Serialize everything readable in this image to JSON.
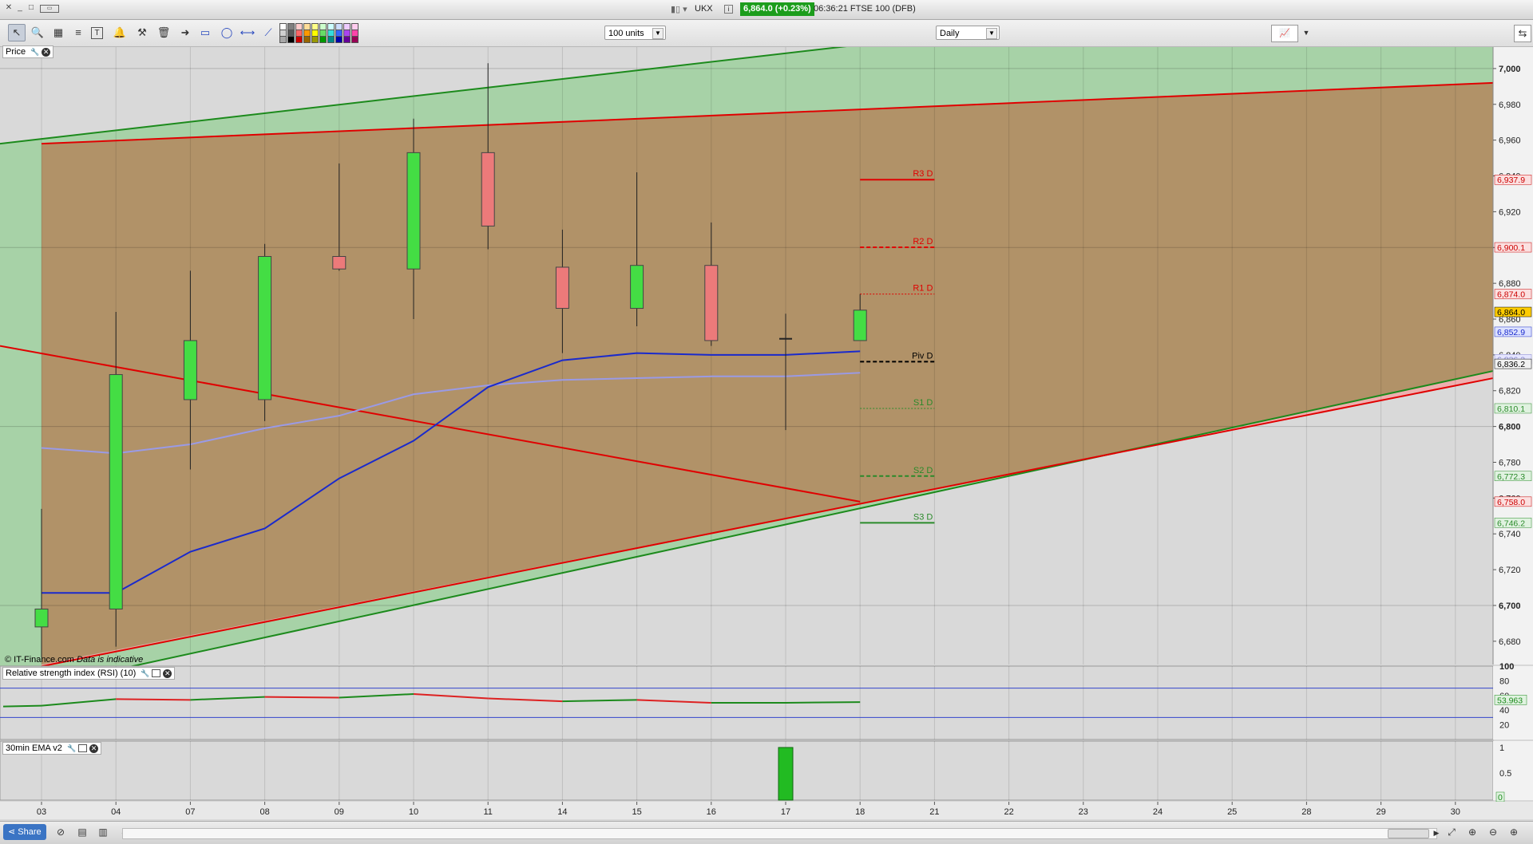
{
  "titlebar": {
    "symbol": "UKX",
    "quote": "6,864.0 (+0.23%)",
    "time_desc": "06:36:21 FTSE 100 (DFB)",
    "win_close": "✕",
    "win_min": "_",
    "win_max": "□",
    "win_pop": "▭"
  },
  "toolbar": {
    "units_select": "100 units",
    "interval_select": "Daily",
    "colors": [
      "#ffffff",
      "#d0d0d0",
      "#a8a8a8",
      "#808080",
      "#585858",
      "#000000",
      "#ffcccc",
      "#ff6666",
      "#cc0000",
      "#ffdd99",
      "#ff9900",
      "#996600",
      "#ffff88",
      "#ffff00",
      "#999900",
      "#ccffcc",
      "#66dd66",
      "#009900",
      "#ccffff",
      "#33dddd",
      "#008888",
      "#ccddff",
      "#3366ff",
      "#0000aa",
      "#eeccff",
      "#aa44ee",
      "#660099",
      "#ffccee",
      "#ff44aa",
      "#990055"
    ]
  },
  "price_panel": {
    "label": "Price"
  },
  "rsi_panel": {
    "label": "Relative strength index (RSI) (10)"
  },
  "ema_panel": {
    "label": "30min EMA v2"
  },
  "copyright": "© IT-Finance.com",
  "copyright_note": "Data is indicative",
  "share_label": "Share",
  "chart_data": {
    "type": "candlestick",
    "x_labels": [
      "03",
      "04",
      "07",
      "08",
      "09",
      "10",
      "11",
      "14",
      "15",
      "16",
      "17",
      "18",
      "21",
      "22",
      "23",
      "24",
      "25",
      "28",
      "29",
      "30"
    ],
    "price_ticks": [
      "6,680",
      "6,700",
      "6,720",
      "6,740",
      "6,760",
      "6,780",
      "6,800",
      "6,820",
      "6,840",
      "6,860",
      "6,880",
      "6,900",
      "6,920",
      "6,940",
      "6,960",
      "6,980",
      "7,000"
    ],
    "price_ylim": [
      6667,
      7012
    ],
    "candles": [
      {
        "day": "03",
        "open": 6688,
        "high": 6754,
        "low": 6671,
        "close": 6698
      },
      {
        "day": "04",
        "open": 6698,
        "high": 6864,
        "low": 6677,
        "close": 6829
      },
      {
        "day": "07",
        "open": 6815,
        "high": 6887,
        "low": 6776,
        "close": 6848
      },
      {
        "day": "08",
        "open": 6815,
        "high": 6902,
        "low": 6803,
        "close": 6895
      },
      {
        "day": "09",
        "open": 6895,
        "high": 6947,
        "low": 6887,
        "close": 6888
      },
      {
        "day": "10",
        "open": 6888,
        "high": 6972,
        "low": 6860,
        "close": 6953
      },
      {
        "day": "11",
        "open": 6953,
        "high": 7003,
        "low": 6899,
        "close": 6912
      },
      {
        "day": "14",
        "open": 6889,
        "high": 6910,
        "low": 6841,
        "close": 6866
      },
      {
        "day": "15",
        "open": 6866,
        "high": 6942,
        "low": 6856,
        "close": 6890
      },
      {
        "day": "16",
        "open": 6890,
        "high": 6914,
        "low": 6845,
        "close": 6848
      },
      {
        "day": "17",
        "open": 6849,
        "high": 6863,
        "low": 6798,
        "close": 6848
      },
      {
        "day": "18",
        "open": 6848,
        "high": 6874,
        "low": 6848,
        "close": 6865
      }
    ],
    "ema_blue": [
      6707,
      6707,
      6730,
      6743,
      6771,
      6792,
      6822,
      6837,
      6841,
      6840,
      6840,
      6842
    ],
    "ema_lavender": [
      6788,
      6785,
      6790,
      6799,
      6806,
      6818,
      6823,
      6826,
      6827,
      6828,
      6828,
      6830
    ],
    "pivots": [
      {
        "label": "R3 D",
        "value": 6937.9,
        "style": "solid",
        "color": "#e00000"
      },
      {
        "label": "R2 D",
        "value": 6900.1,
        "style": "dashed",
        "color": "#e00000"
      },
      {
        "label": "R1 D",
        "value": 6874.0,
        "style": "dotted",
        "color": "#e00000"
      },
      {
        "label": "Piv D",
        "value": 6836.2,
        "style": "dashed",
        "color": "#000000"
      },
      {
        "label": "S1 D",
        "value": 6810.1,
        "style": "dotted",
        "color": "#2a8a2a"
      },
      {
        "label": "S2 D",
        "value": 6772.3,
        "style": "dashed",
        "color": "#2a8a2a"
      },
      {
        "label": "S3 D",
        "value": 6746.2,
        "style": "solid",
        "color": "#2a8a2a"
      }
    ],
    "right_tags": [
      {
        "text": "6,937.9",
        "value": 6937.9,
        "bg": "#fbe0e0",
        "fg": "#cc0000"
      },
      {
        "text": "6,900.1",
        "value": 6900.1,
        "bg": "#fbe0e0",
        "fg": "#cc0000"
      },
      {
        "text": "6,874.0",
        "value": 6874.0,
        "bg": "#fbe0e0",
        "fg": "#cc0000"
      },
      {
        "text": "6,864.0",
        "value": 6864.0,
        "bg": "#ffcc00",
        "fg": "#000000"
      },
      {
        "text": "6,852.9",
        "value": 6852.9,
        "bg": "#dde2ff",
        "fg": "#1a2acc"
      },
      {
        "text": "6,836.2",
        "value": 6837.6,
        "bg": "#e6e6ff",
        "fg": "#8888cc"
      },
      {
        "text": "6,836.2",
        "value": 6835.0,
        "bg": "#f2f2f2",
        "fg": "#000000"
      },
      {
        "text": "6,810.1",
        "value": 6810.1,
        "bg": "#e0f2e0",
        "fg": "#2a8a2a"
      },
      {
        "text": "6,772.3",
        "value": 6772.3,
        "bg": "#e0f2e0",
        "fg": "#2a8a2a"
      },
      {
        "text": "6,758.0",
        "value": 6758.0,
        "bg": "#fbe0e0",
        "fg": "#cc0000"
      },
      {
        "text": "6,746.2",
        "value": 6746.2,
        "bg": "#e0f2e0",
        "fg": "#2a8a2a"
      }
    ],
    "rsi": {
      "ticks": [
        "100",
        "80",
        "60",
        "40",
        "20"
      ],
      "ylim": [
        0,
        100
      ],
      "upper": 70,
      "lower": 30,
      "values": [
        45,
        46,
        55,
        54,
        58,
        57,
        62,
        56,
        52,
        54,
        50,
        50,
        51
      ],
      "value_tag": "53.963"
    },
    "ema30": {
      "ticks": [
        "1",
        "0.5",
        "0"
      ],
      "ylim": [
        0,
        1
      ],
      "bar_day": "17",
      "bar_value": 1,
      "value_tag": "0"
    },
    "colors": {
      "bull": "#44dd44",
      "bear": "#ec7a7a",
      "red_channel": "#e00000",
      "green_channel": "#1c8a1c",
      "ema_blue": "#1a2acc",
      "ema_lavender": "#9a9ae6"
    }
  }
}
